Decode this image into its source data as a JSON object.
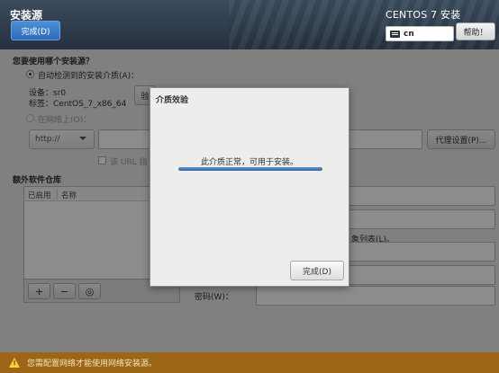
{
  "header": {
    "page_title": "安装源",
    "done_label": "完成(D)",
    "product_title": "CENTOS 7 安装",
    "keyboard_layout": "cn",
    "help_label": "帮助！"
  },
  "source": {
    "question": "您要使用哪个安装源？",
    "auto_detect_label": "自动检测到的安装介质(A)：",
    "device_label": "设备：sr0",
    "label_label": "标签：CentOS_7_x86_64",
    "verify_button": "验",
    "network_label": "在网络上(O)：",
    "protocol": "http://",
    "url_value": "",
    "proxy_button": "代理设置(P)...",
    "url_checkbox_label": "该 URL 指"
  },
  "repos": {
    "heading": "额外软件仓库",
    "columns": [
      "已启用",
      "名称"
    ],
    "add_label": "+",
    "remove_label": "−",
    "reset_label": "◎"
  },
  "right_form": {
    "mirror_hint": "象列表(L)。",
    "password_label": "密码(W)："
  },
  "dialog": {
    "title": "介质效验",
    "message": "此介质正常，可用于安装。",
    "progress": 1.0,
    "done_label": "完成(D)"
  },
  "warning": {
    "text": "您需配置网络才能使用网络安装源。"
  }
}
